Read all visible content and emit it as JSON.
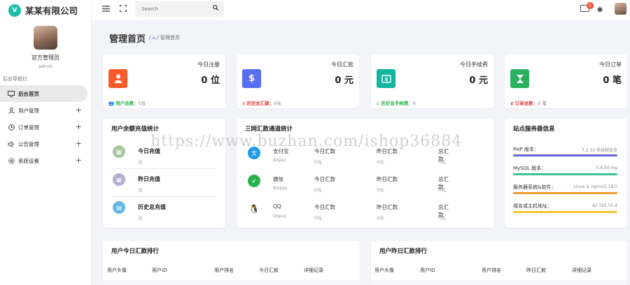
{
  "app": {
    "title": "某某有限公司",
    "logo_glyph": "V"
  },
  "profile": {
    "name": "官方管理员",
    "role": "admin"
  },
  "nav": {
    "section_label": "后台导航栏",
    "items": [
      {
        "label": "后台首页",
        "icon": "monitor-icon",
        "active": true,
        "expandable": false
      },
      {
        "label": "用户管理",
        "icon": "user-icon",
        "active": false,
        "expandable": true
      },
      {
        "label": "订单管理",
        "icon": "clock-icon",
        "active": false,
        "expandable": true
      },
      {
        "label": "公告管理",
        "icon": "speaker-icon",
        "active": false,
        "expandable": true
      },
      {
        "label": "系统设置",
        "icon": "settings-icon",
        "active": false,
        "expandable": true
      }
    ]
  },
  "header": {
    "search_placeholder": "Search",
    "mail_badge": "0"
  },
  "page": {
    "title": "管理首页",
    "breadcrumb_sep": "/",
    "breadcrumb_current": "管理首页"
  },
  "stats": [
    {
      "label": "今日注册",
      "value": "0 位",
      "sub_key": "用户总数：",
      "sub_value": "1位",
      "color": "#fa5a2a",
      "sub_color": "#27b24a",
      "icon": "user-icon"
    },
    {
      "label": "今日汇款",
      "value": "0 元",
      "sub_key": "历史总汇款：",
      "sub_value": "0元",
      "color": "#5a6cf0",
      "sub_color": "#e53935",
      "icon": "dollar-icon"
    },
    {
      "label": "今日手续费",
      "value": "0 元",
      "sub_key": "历史总手续费：",
      "sub_value": "0",
      "color": "#13b59d",
      "sub_color": "#27b24a",
      "icon": "money-icon"
    },
    {
      "label": "今日订单",
      "value": "0 笔",
      "sub_key": "订单总数：",
      "sub_value": "0 笔",
      "color": "#2ab05e",
      "sub_color": "#e53935",
      "icon": "hourglass-icon"
    }
  ],
  "recharge": {
    "title": "用户余额充值统计",
    "items": [
      {
        "label": "今日充值",
        "value": "元",
        "color": "#a9c8a0"
      },
      {
        "label": "昨日充值",
        "value": "元",
        "color": "#b5aed0"
      },
      {
        "label": "历史总充值",
        "value": "元",
        "color": "#65b9e6"
      }
    ]
  },
  "channels": {
    "title": "三网汇款通道统计",
    "rows": [
      {
        "name": "支付宝",
        "sub": "Alipay",
        "color": "#1e9be8",
        "icon": "alipay-icon",
        "today_label": "今日汇款",
        "today": "0元",
        "yest_label": "昨日汇款",
        "yest": "0元",
        "total_label": "总汇款",
        "total": "0元"
      },
      {
        "name": "微信",
        "sub": "Wxpay",
        "color": "#2ab14c",
        "icon": "wechat-icon",
        "today_label": "今日汇款",
        "today": "0元",
        "yest_label": "昨日汇款",
        "yest": "0元",
        "total_label": "总汇款",
        "total": "0元"
      },
      {
        "name": "QQ",
        "sub": "Qqpay",
        "color": "#222222",
        "icon": "qq-icon",
        "today_label": "今日汇款",
        "today": "0元",
        "yest_label": "昨日汇款",
        "yest": "0元",
        "total_label": "总汇款",
        "total": "0元"
      }
    ]
  },
  "server": {
    "title": "站点服务器信息",
    "rows": [
      {
        "label": "PHP 版本：",
        "value": "7.2.33 非线程安全",
        "color": "#6b63d6"
      },
      {
        "label": "MySQL 版本：",
        "value": "5.6.50-log",
        "color": "#3fc08f"
      },
      {
        "label": "服务器系统&软件：",
        "value": "Linux & nginx/1.18.0",
        "color": "#f39c33"
      },
      {
        "label": "域名或主机地址：",
        "value": "42.193.55.4",
        "color": "#f4c531"
      }
    ]
  },
  "today_rank": {
    "title": "用户今日汇款排行",
    "headers": [
      "用户头像",
      "用户ID",
      "用户排名",
      "今日汇款",
      "详细记录"
    ]
  },
  "yesterday_rank": {
    "title": "用户昨日汇款排行",
    "headers": [
      "用户头像",
      "用户ID",
      "用户排名",
      "昨日汇款",
      "详细记录"
    ]
  },
  "watermark": "https://www.buzhan.com/ishop36884"
}
